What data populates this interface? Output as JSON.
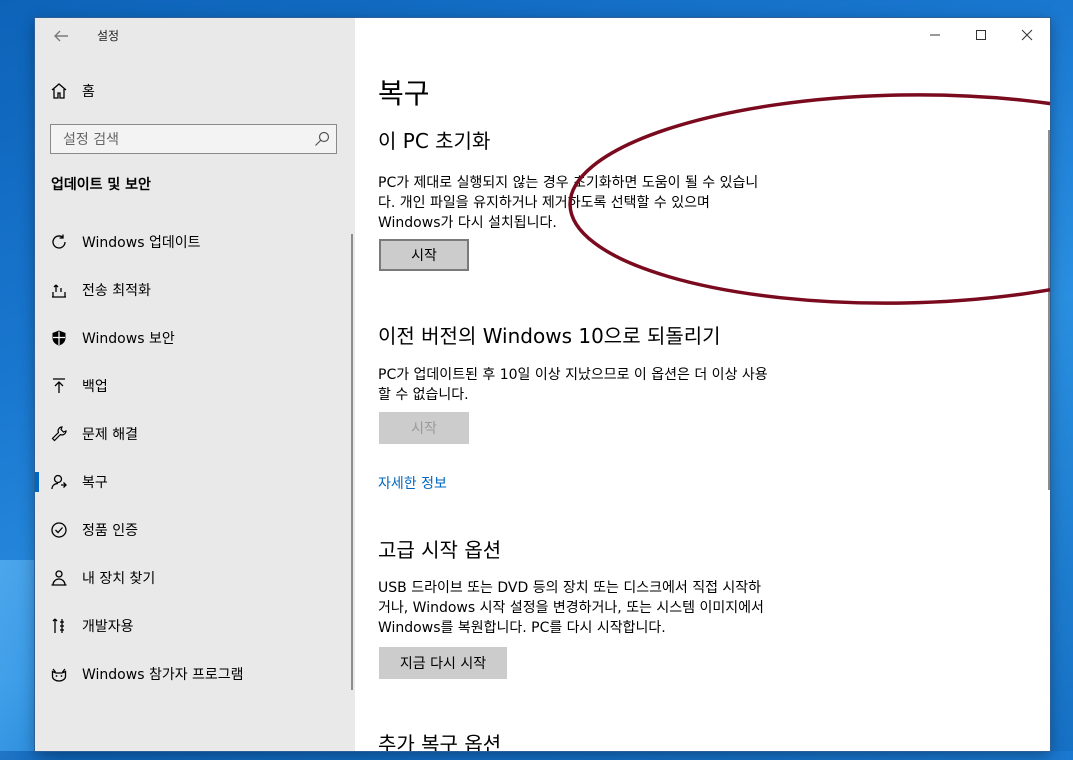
{
  "app": {
    "title": "설정"
  },
  "sidebar": {
    "home_label": "홈",
    "search_placeholder": "설정 검색",
    "section_heading": "업데이트 및 보안",
    "items": [
      {
        "id": "windows-update",
        "label": "Windows 업데이트",
        "icon": "refresh-icon"
      },
      {
        "id": "delivery-optimization",
        "label": "전송 최적화",
        "icon": "upload-tray-icon"
      },
      {
        "id": "windows-security",
        "label": "Windows 보안",
        "icon": "shield-icon"
      },
      {
        "id": "backup",
        "label": "백업",
        "icon": "arrow-up-icon"
      },
      {
        "id": "troubleshoot",
        "label": "문제 해결",
        "icon": "wrench-icon"
      },
      {
        "id": "recovery",
        "label": "복구",
        "icon": "person-recovery-icon",
        "selected": true
      },
      {
        "id": "activation",
        "label": "정품 인증",
        "icon": "check-circle-icon"
      },
      {
        "id": "find-my-device",
        "label": "내 장치 찾기",
        "icon": "person-locate-icon"
      },
      {
        "id": "for-developers",
        "label": "개발자용",
        "icon": "developer-tools-icon"
      },
      {
        "id": "insider-program",
        "label": "Windows 참가자 프로그램",
        "icon": "cat-face-icon"
      }
    ]
  },
  "main": {
    "page_title": "복구",
    "reset": {
      "heading": "이 PC 초기화",
      "lines": [
        "PC가 제대로 실행되지 않는 경우 초기화하면 도움이 될 수 있습니",
        "다. 개인 파일을 유지하거나 제거하도록 선택할 수 있으며",
        "Windows가 다시 설치됩니다."
      ],
      "button": "시작"
    },
    "rollback": {
      "heading": "이전 버전의 Windows 10으로 되돌리기",
      "lines": [
        "PC가 업데이트된 후 10일 이상 지났으므로 이 옵션은 더 이상 사용",
        "할 수 없습니다."
      ],
      "button": "시작",
      "link": "자세한 정보"
    },
    "advanced": {
      "heading": "고급 시작 옵션",
      "lines": [
        "USB 드라이브 또는 DVD 등의 장치 또는 디스크에서 직접 시작하",
        "거나, Windows 시작 설정을 변경하거나, 또는 시스템 이미지에서",
        "Windows를 복원합니다. PC를 다시 시작합니다."
      ],
      "button": "지금 다시 시작"
    },
    "more": {
      "heading": "추가 복구 옵션"
    }
  },
  "colors": {
    "accent": "#0067c0",
    "annotation": "#7a0a1e",
    "sidebar_bg": "#e9e9e9"
  }
}
